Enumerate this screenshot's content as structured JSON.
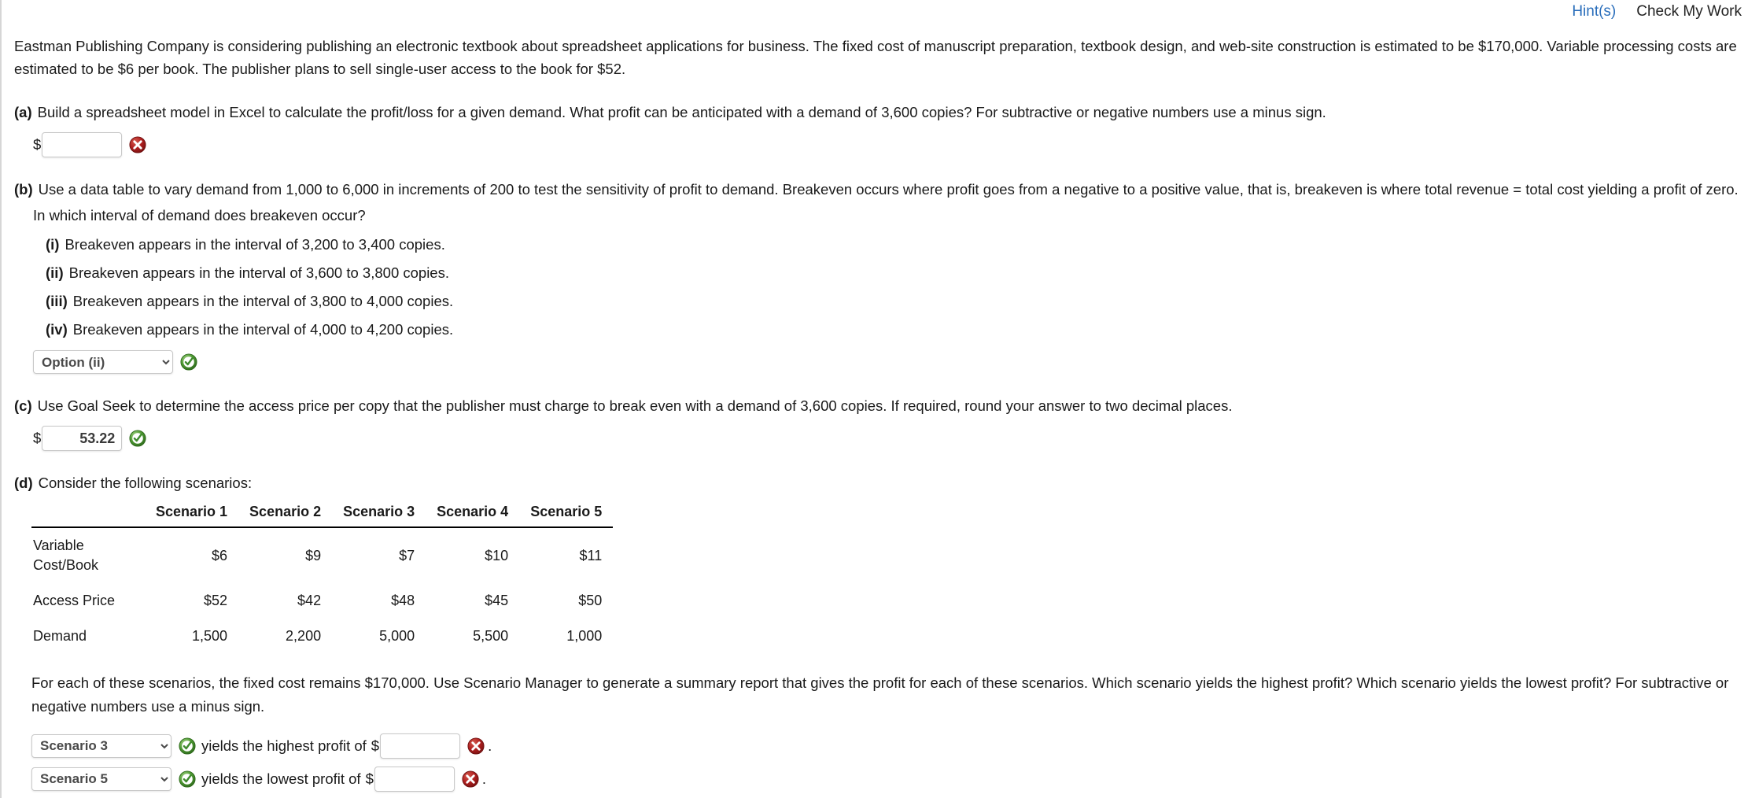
{
  "topbar": {
    "hint_label": "Hint(s)",
    "check_label": "Check My Work"
  },
  "intro": "Eastman Publishing Company is considering publishing an electronic textbook about spreadsheet applications for business. The fixed cost of manuscript preparation, textbook design, and web-site construction is estimated to be $170,000. Variable processing costs are estimated to be $6 per book. The publisher plans to sell single-user access to the book for $52.",
  "parts": {
    "a": {
      "label": "(a)",
      "text": "Build a spreadsheet model in Excel to calculate the profit/loss for a given demand. What profit can be anticipated with a demand of 3,600 copies? For subtractive or negative numbers use a minus sign.",
      "currency_symbol": "$",
      "value": "",
      "status": "incorrect"
    },
    "b": {
      "label": "(b)",
      "text": "Use a data table to vary demand from 1,000 to 6,000 in increments of 200 to test the sensitivity of profit to demand. Breakeven occurs where profit goes from a negative to a positive value, that is, breakeven is where total revenue = total cost yielding a profit of zero.",
      "subtext": "In which interval of demand does breakeven occur?",
      "options": [
        {
          "num": "(i)",
          "text": "Breakeven appears in the interval of 3,200 to 3,400 copies."
        },
        {
          "num": "(ii)",
          "text": "Breakeven appears in the interval of 3,600 to 3,800 copies."
        },
        {
          "num": "(iii)",
          "text": "Breakeven appears in the interval of 3,800 to 4,000 copies."
        },
        {
          "num": "(iv)",
          "text": "Breakeven appears in the interval of 4,000 to 4,200 copies."
        }
      ],
      "select_value": "Option (ii)",
      "select_options": [
        "Option (i)",
        "Option (ii)",
        "Option (iii)",
        "Option (iv)"
      ],
      "status": "correct"
    },
    "c": {
      "label": "(c)",
      "text": "Use Goal Seek to determine the access price per copy that the publisher must charge to break even with a demand of 3,600 copies. If required, round your answer to two decimal places.",
      "currency_symbol": "$",
      "value": "53.22",
      "status": "correct"
    },
    "d": {
      "label": "(d)",
      "text": "Consider the following scenarios:",
      "table": {
        "column_headers": [
          "",
          "Scenario 1",
          "Scenario 2",
          "Scenario 3",
          "Scenario 4",
          "Scenario 5"
        ],
        "rows": [
          {
            "header": "Variable Cost/Book",
            "values": [
              "$6",
              "$9",
              "$7",
              "$10",
              "$11"
            ]
          },
          {
            "header": "Access Price",
            "values": [
              "$52",
              "$42",
              "$48",
              "$45",
              "$50"
            ]
          },
          {
            "header": "Demand",
            "values": [
              "1,500",
              "2,200",
              "5,000",
              "5,500",
              "1,000"
            ]
          }
        ]
      },
      "paragraph": "For each of these scenarios, the fixed cost remains $170,000. Use Scenario Manager to generate a summary report that gives the profit for each of these scenarios. Which scenario yields the highest profit? Which scenario yields the lowest profit? For subtractive or negative numbers use a minus sign.",
      "highest": {
        "select_value": "Scenario 3",
        "select_options": [
          "Scenario 1",
          "Scenario 2",
          "Scenario 3",
          "Scenario 4",
          "Scenario 5"
        ],
        "select_status": "correct",
        "mid_text": "yields the highest profit of",
        "currency_symbol": "$",
        "value": "",
        "value_status": "incorrect",
        "trailing": "."
      },
      "lowest": {
        "select_value": "Scenario 5",
        "select_options": [
          "Scenario 1",
          "Scenario 2",
          "Scenario 3",
          "Scenario 4",
          "Scenario 5"
        ],
        "select_status": "correct",
        "mid_text": "yields the lowest profit of",
        "currency_symbol": "$",
        "value": "",
        "value_status": "incorrect",
        "trailing": "."
      }
    }
  },
  "icons": {
    "correct_name": "correct-check-icon",
    "incorrect_name": "incorrect-x-icon",
    "correct_color": "#3f8a2e",
    "incorrect_color": "#a81d1d"
  }
}
